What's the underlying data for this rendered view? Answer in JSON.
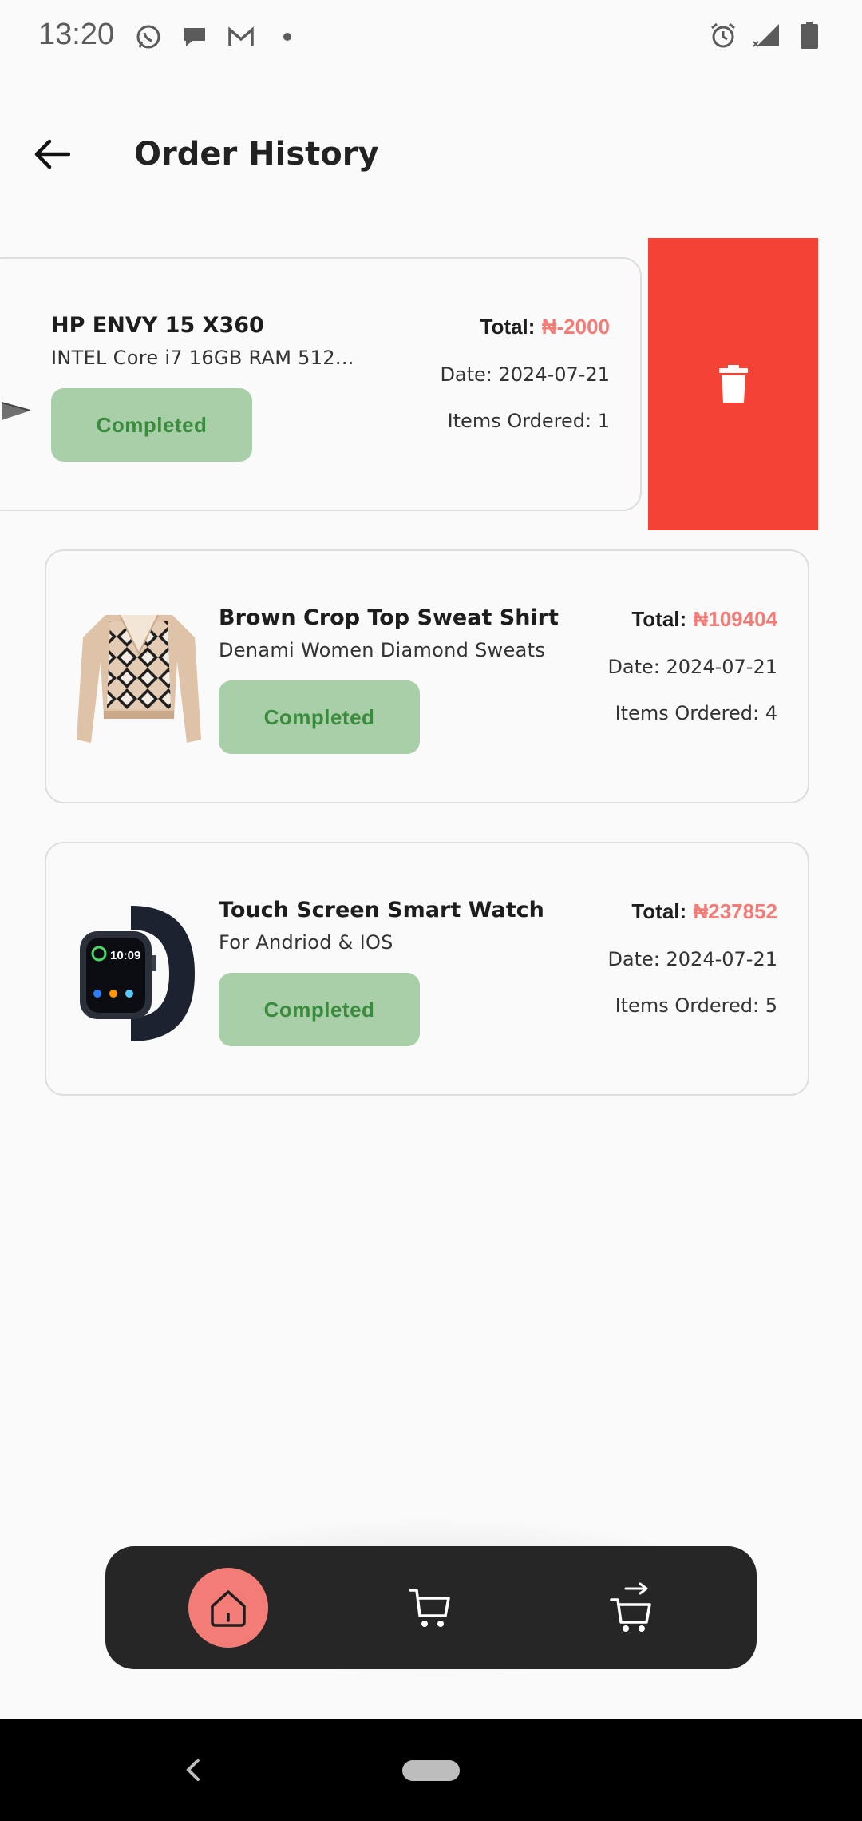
{
  "status_bar": {
    "time": "13:20"
  },
  "app_bar": {
    "title": "Order History"
  },
  "orders": [
    {
      "name": "HP ENVY 15 X360",
      "description": "INTEL Core i7 16GB RAM 512...",
      "status": "Completed",
      "total_label": "Total:",
      "total_value": "₦-2000",
      "date": "Date: 2024-07-21",
      "items": "Items Ordered: 1",
      "image": "laptop"
    },
    {
      "name": "Brown Crop Top Sweat Shirt",
      "description": "Denami Women Diamond Sweats",
      "status": "Completed",
      "total_label": "Total:",
      "total_value": "₦109404",
      "date": "Date: 2024-07-21",
      "items": "Items Ordered: 4",
      "image": "sweater"
    },
    {
      "name": "Touch Screen Smart Watch",
      "description": "For Andriod & IOS",
      "status": "Completed",
      "total_label": "Total:",
      "total_value": "₦237852",
      "date": "Date: 2024-07-21",
      "items": "Items Ordered: 5",
      "image": "smartwatch",
      "watch_time": "10:09"
    }
  ],
  "colors": {
    "accent": "#f47c76",
    "status_bg": "#a9cfa9",
    "status_text": "#3a8b3d",
    "delete": "#f44336",
    "nav_bg": "#262626"
  },
  "bottom_nav": {
    "items": [
      "home-icon",
      "cart-icon",
      "checkout-cart-icon"
    ],
    "active": "home-icon"
  }
}
